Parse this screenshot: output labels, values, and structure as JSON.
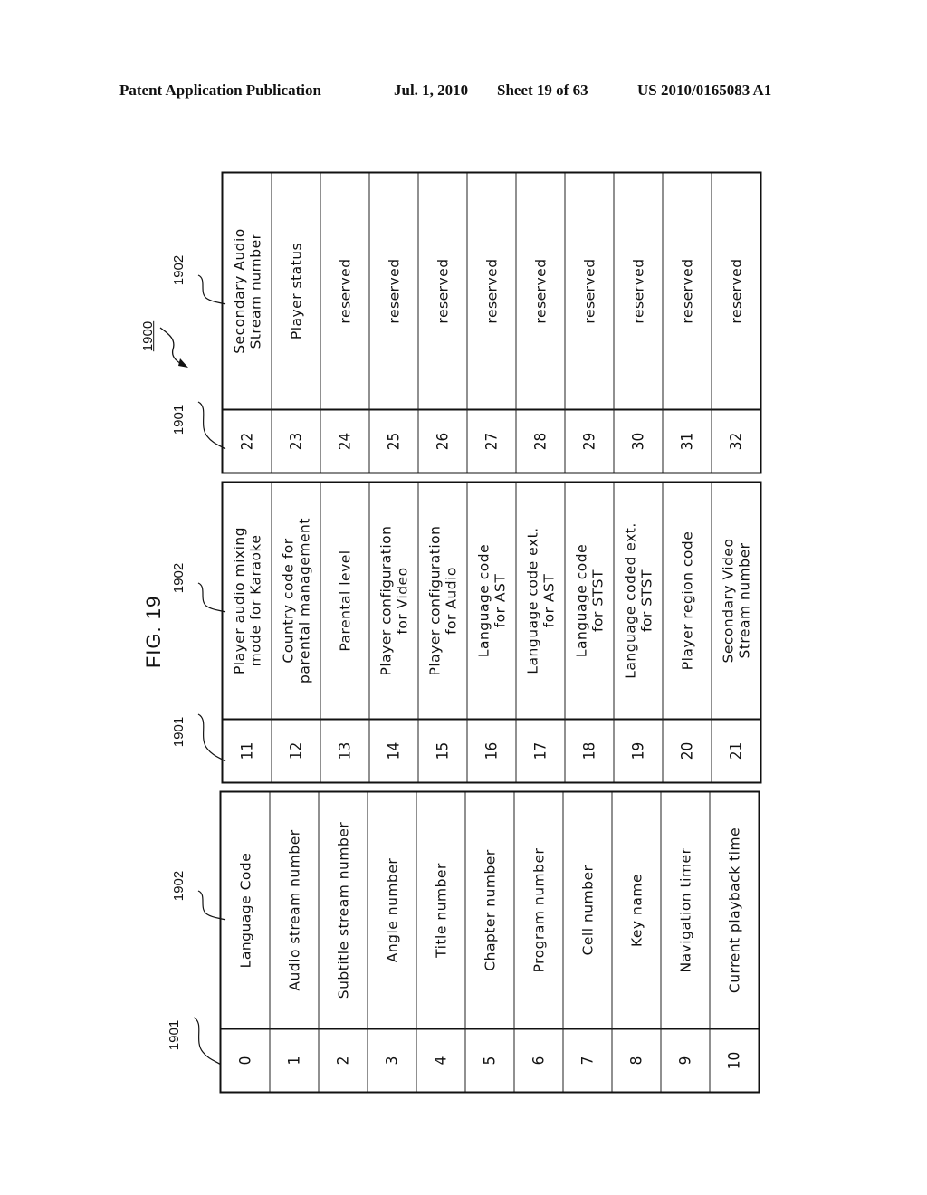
{
  "header": {
    "publication": "Patent Application Publication",
    "date": "Jul. 1, 2010",
    "sheet": "Sheet 19 of 63",
    "number": "US 2010/0165083 A1"
  },
  "figure": {
    "title": "FIG. 19",
    "ref_table": "1900",
    "ref_number_col": "1901",
    "ref_name_col": "1902"
  },
  "tables": [
    {
      "rows": [
        {
          "n": "0",
          "label": "Language Code"
        },
        {
          "n": "1",
          "label": "Audio stream number"
        },
        {
          "n": "2",
          "label": "Subtitle stream number"
        },
        {
          "n": "3",
          "label": "Angle number"
        },
        {
          "n": "4",
          "label": "Title number"
        },
        {
          "n": "5",
          "label": "Chapter number"
        },
        {
          "n": "6",
          "label": "Program number"
        },
        {
          "n": "7",
          "label": "Cell number"
        },
        {
          "n": "8",
          "label": "Key name"
        },
        {
          "n": "9",
          "label": "Navigation timer"
        },
        {
          "n": "10",
          "label": "Current playback time"
        }
      ]
    },
    {
      "rows": [
        {
          "n": "11",
          "label": "Player audio mixing\nmode for Karaoke"
        },
        {
          "n": "12",
          "label": "Country code for\nparental management"
        },
        {
          "n": "13",
          "label": "Parental level"
        },
        {
          "n": "14",
          "label": "Player configuration\nfor Video"
        },
        {
          "n": "15",
          "label": "Player configuration\nfor Audio"
        },
        {
          "n": "16",
          "label": "Language code\nfor AST"
        },
        {
          "n": "17",
          "label": "Language code ext.\nfor AST"
        },
        {
          "n": "18",
          "label": "Language code\nfor STST"
        },
        {
          "n": "19",
          "label": "Language coded ext.\nfor STST"
        },
        {
          "n": "20",
          "label": "Player region code"
        },
        {
          "n": "21",
          "label": "Secondary Video\nStream number"
        }
      ]
    },
    {
      "rows": [
        {
          "n": "22",
          "label": "Secondary Audio\nStream number"
        },
        {
          "n": "23",
          "label": "Player status"
        },
        {
          "n": "24",
          "label": "reserved"
        },
        {
          "n": "25",
          "label": "reserved"
        },
        {
          "n": "26",
          "label": "reserved"
        },
        {
          "n": "27",
          "label": "reserved"
        },
        {
          "n": "28",
          "label": "reserved"
        },
        {
          "n": "29",
          "label": "reserved"
        },
        {
          "n": "30",
          "label": "reserved"
        },
        {
          "n": "31",
          "label": "reserved"
        },
        {
          "n": "32",
          "label": "reserved"
        }
      ]
    }
  ]
}
